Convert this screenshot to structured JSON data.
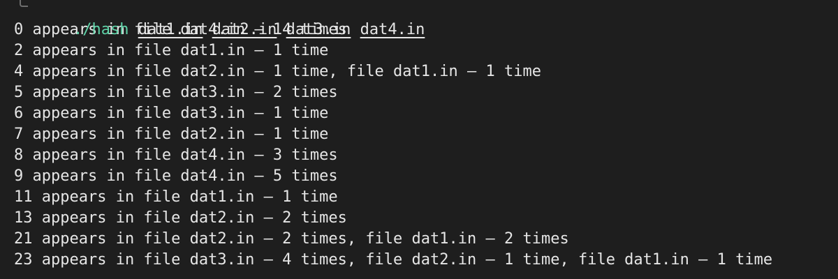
{
  "command": {
    "program": "./hash",
    "args": [
      "dat1.in",
      "dat2.in",
      "dat3.in",
      "dat4.in"
    ]
  },
  "output_lines": [
    "0 appears in file dat4.in – 14 times",
    "2 appears in file dat1.in – 1 time",
    "4 appears in file dat2.in – 1 time, file dat1.in – 1 time",
    "5 appears in file dat3.in – 2 times",
    "6 appears in file dat3.in – 1 time",
    "7 appears in file dat2.in – 1 time",
    "8 appears in file dat4.in – 3 times",
    "9 appears in file dat4.in – 5 times",
    "11 appears in file dat1.in – 1 time",
    "13 appears in file dat2.in – 2 times",
    "21 appears in file dat2.in – 2 times, file dat1.in – 2 times",
    "23 appears in file dat3.in – 4 times, file dat2.in – 1 time, file dat1.in – 1 time"
  ],
  "colors": {
    "background": "#1e1e1e",
    "text": "#e6e6e6",
    "command": "#5fd3a8"
  }
}
